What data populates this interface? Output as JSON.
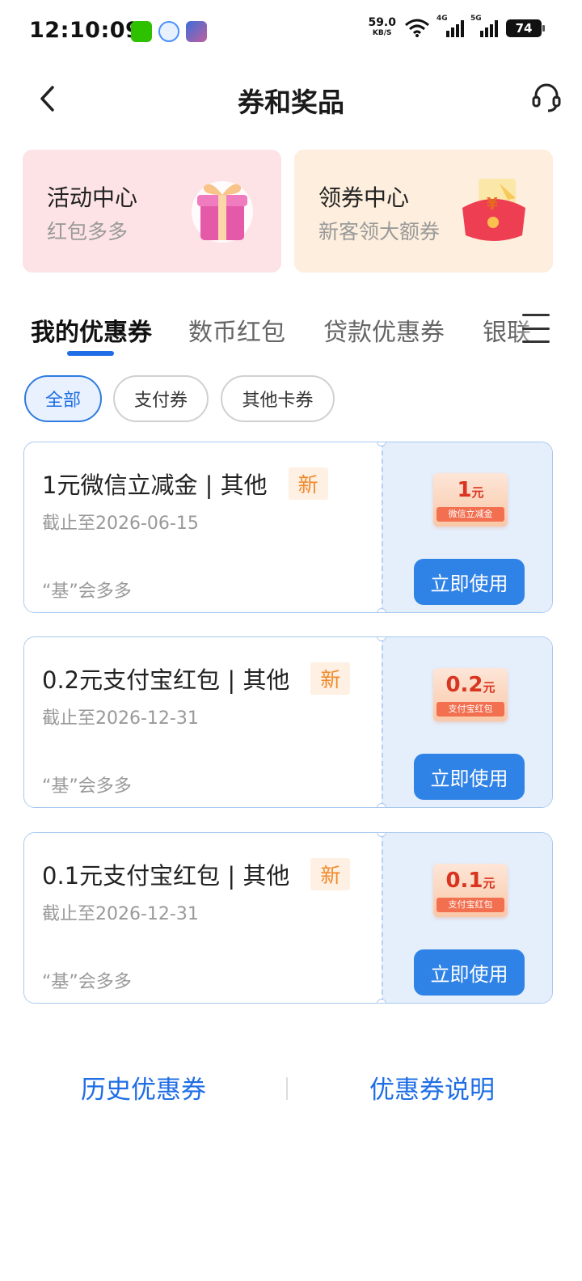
{
  "status_bar": {
    "time": "12:10:09",
    "net_speed": "59.0",
    "net_unit": "KB/S",
    "sig1_label": "4G",
    "sig2_label": "5G",
    "battery": "74"
  },
  "header": {
    "title": "券和奖品"
  },
  "promos": [
    {
      "title": "活动中心",
      "subtitle": "红包多多"
    },
    {
      "title": "领券中心",
      "subtitle": "新客领大额券"
    }
  ],
  "tabs": [
    "我的优惠券",
    "数币红包",
    "贷款优惠券",
    "银联"
  ],
  "chips": [
    "全部",
    "支付券",
    "其他卡券"
  ],
  "coupons": [
    {
      "title": "1元微信立减金 | 其他",
      "badge": "新",
      "expiry": "截止至2026-06-15",
      "source": "“基”会多多",
      "amount": "1",
      "unit": "元",
      "ticket_label": "微信立减金",
      "button": "立即使用"
    },
    {
      "title": "0.2元支付宝红包 | 其他",
      "badge": "新",
      "expiry": "截止至2026-12-31",
      "source": "“基”会多多",
      "amount": "0.2",
      "unit": "元",
      "ticket_label": "支付宝红包",
      "button": "立即使用"
    },
    {
      "title": "0.1元支付宝红包 | 其他",
      "badge": "新",
      "expiry": "截止至2026-12-31",
      "source": "“基”会多多",
      "amount": "0.1",
      "unit": "元",
      "ticket_label": "支付宝红包",
      "button": "立即使用"
    }
  ],
  "footer": {
    "history": "历史优惠券",
    "explain": "优惠券说明"
  },
  "colors": {
    "accent": "#1f6ee6",
    "button": "#2f82e6",
    "new_badge": "#f08a2a"
  }
}
